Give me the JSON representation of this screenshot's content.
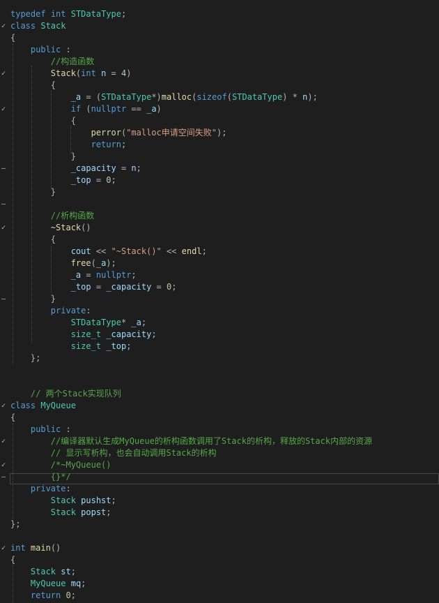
{
  "colors": {
    "background": "#1e1e1e",
    "keyword": "#569cd6",
    "type": "#4ec9b0",
    "function": "#dcdcaa",
    "variable": "#9cdcfe",
    "number": "#b5cea8",
    "string": "#d69d85",
    "comment": "#57a64a",
    "punctuation": "#b4b4b4",
    "macro": "#beb7ff"
  },
  "lines": [
    {
      "fold": "",
      "tokens": [
        [
          "kw",
          "typedef"
        ],
        [
          "pun",
          " "
        ],
        [
          "kw",
          "int"
        ],
        [
          "pun",
          " "
        ],
        [
          "type",
          "STDataType"
        ],
        [
          "pun",
          ";"
        ]
      ]
    },
    {
      "fold": "✓",
      "tokens": [
        [
          "kw",
          "class"
        ],
        [
          "pun",
          " "
        ],
        [
          "type",
          "Stack"
        ]
      ]
    },
    {
      "fold": "",
      "tokens": [
        [
          "pun",
          "{"
        ]
      ]
    },
    {
      "fold": "",
      "tokens": [
        [
          "pun",
          "    "
        ],
        [
          "kw",
          "public"
        ],
        [
          "pun",
          " :"
        ]
      ]
    },
    {
      "fold": "",
      "tokens": [
        [
          "pun",
          "        "
        ],
        [
          "cmt",
          "//构造函数"
        ]
      ]
    },
    {
      "fold": "✓",
      "tokens": [
        [
          "pun",
          "        "
        ],
        [
          "fn",
          "Stack"
        ],
        [
          "pun",
          "("
        ],
        [
          "kw",
          "int"
        ],
        [
          "pun",
          " "
        ],
        [
          "var",
          "n"
        ],
        [
          "pun",
          " = "
        ],
        [
          "num",
          "4"
        ],
        [
          "pun",
          ")"
        ]
      ]
    },
    {
      "fold": "",
      "tokens": [
        [
          "pun",
          "        {"
        ]
      ]
    },
    {
      "fold": "",
      "tokens": [
        [
          "pun",
          "            "
        ],
        [
          "var",
          "_a"
        ],
        [
          "pun",
          " = ("
        ],
        [
          "type",
          "STDataType"
        ],
        [
          "pun",
          "*)"
        ],
        [
          "fn",
          "malloc"
        ],
        [
          "pun",
          "("
        ],
        [
          "kw",
          "sizeof"
        ],
        [
          "pun",
          "("
        ],
        [
          "type",
          "STDataType"
        ],
        [
          "pun",
          ") * "
        ],
        [
          "var",
          "n"
        ],
        [
          "pun",
          ");"
        ]
      ]
    },
    {
      "fold": "✓",
      "tokens": [
        [
          "pun",
          "            "
        ],
        [
          "kw",
          "if"
        ],
        [
          "pun",
          " ("
        ],
        [
          "kw",
          "nullptr"
        ],
        [
          "pun",
          " == "
        ],
        [
          "var",
          "_a"
        ],
        [
          "pun",
          ")"
        ]
      ]
    },
    {
      "fold": "",
      "tokens": [
        [
          "pun",
          "            {"
        ]
      ]
    },
    {
      "fold": "",
      "tokens": [
        [
          "pun",
          "                "
        ],
        [
          "fn",
          "perror"
        ],
        [
          "pun",
          "("
        ],
        [
          "str",
          "\"malloc申请空间失败\""
        ],
        [
          "pun",
          ");"
        ]
      ]
    },
    {
      "fold": "",
      "tokens": [
        [
          "pun",
          "                "
        ],
        [
          "kw",
          "return"
        ],
        [
          "pun",
          ";"
        ]
      ]
    },
    {
      "fold": "",
      "tokens": [
        [
          "pun",
          "            }"
        ]
      ]
    },
    {
      "fold": "–",
      "tokens": [
        [
          "pun",
          "            "
        ],
        [
          "var",
          "_capacity"
        ],
        [
          "pun",
          " = "
        ],
        [
          "var",
          "n"
        ],
        [
          "pun",
          ";"
        ]
      ]
    },
    {
      "fold": "",
      "tokens": [
        [
          "pun",
          "            "
        ],
        [
          "var",
          "_top"
        ],
        [
          "pun",
          " = "
        ],
        [
          "num",
          "0"
        ],
        [
          "pun",
          ";"
        ]
      ]
    },
    {
      "fold": "",
      "tokens": [
        [
          "pun",
          "        }"
        ]
      ]
    },
    {
      "fold": "–",
      "tokens": []
    },
    {
      "fold": "",
      "tokens": [
        [
          "pun",
          "        "
        ],
        [
          "cmt",
          "//析构函数"
        ]
      ]
    },
    {
      "fold": "✓",
      "tokens": [
        [
          "pun",
          "        "
        ],
        [
          "fn",
          "~Stack"
        ],
        [
          "pun",
          "()"
        ]
      ]
    },
    {
      "fold": "",
      "tokens": [
        [
          "pun",
          "        {"
        ]
      ]
    },
    {
      "fold": "",
      "tokens": [
        [
          "pun",
          "            "
        ],
        [
          "var",
          "cout"
        ],
        [
          "pun",
          " << "
        ],
        [
          "str",
          "\"~Stack()\""
        ],
        [
          "pun",
          " << "
        ],
        [
          "fn",
          "endl"
        ],
        [
          "pun",
          ";"
        ]
      ]
    },
    {
      "fold": "",
      "tokens": [
        [
          "pun",
          "            "
        ],
        [
          "fn",
          "free"
        ],
        [
          "pun",
          "("
        ],
        [
          "var",
          "_a"
        ],
        [
          "pun",
          ");"
        ]
      ]
    },
    {
      "fold": "",
      "tokens": [
        [
          "pun",
          "            "
        ],
        [
          "var",
          "_a"
        ],
        [
          "pun",
          " = "
        ],
        [
          "kw",
          "nullptr"
        ],
        [
          "pun",
          ";"
        ]
      ]
    },
    {
      "fold": "",
      "tokens": [
        [
          "pun",
          "            "
        ],
        [
          "var",
          "_top"
        ],
        [
          "pun",
          " = "
        ],
        [
          "var",
          "_capacity"
        ],
        [
          "pun",
          " = "
        ],
        [
          "num",
          "0"
        ],
        [
          "pun",
          ";"
        ]
      ]
    },
    {
      "fold": "–",
      "tokens": [
        [
          "pun",
          "        }"
        ]
      ]
    },
    {
      "fold": "",
      "tokens": [
        [
          "pun",
          "        "
        ],
        [
          "kw",
          "private"
        ],
        [
          "pun",
          ":"
        ]
      ]
    },
    {
      "fold": "",
      "tokens": [
        [
          "pun",
          "            "
        ],
        [
          "type",
          "STDataType"
        ],
        [
          "pun",
          "* "
        ],
        [
          "var",
          "_a"
        ],
        [
          "pun",
          ";"
        ]
      ]
    },
    {
      "fold": "",
      "tokens": [
        [
          "pun",
          "            "
        ],
        [
          "type",
          "size_t"
        ],
        [
          "pun",
          " "
        ],
        [
          "var",
          "_capacity"
        ],
        [
          "pun",
          ";"
        ]
      ]
    },
    {
      "fold": "",
      "tokens": [
        [
          "pun",
          "            "
        ],
        [
          "type",
          "size_t"
        ],
        [
          "pun",
          " "
        ],
        [
          "var",
          "_top"
        ],
        [
          "pun",
          ";"
        ]
      ]
    },
    {
      "fold": "",
      "tokens": [
        [
          "pun",
          "    };"
        ]
      ]
    },
    {
      "fold": "",
      "tokens": []
    },
    {
      "fold": "",
      "tokens": []
    },
    {
      "fold": "",
      "tokens": [
        [
          "pun",
          "    "
        ],
        [
          "cmt",
          "// 两个Stack实现队列"
        ]
      ]
    },
    {
      "fold": "✓",
      "tokens": [
        [
          "kw",
          "class"
        ],
        [
          "pun",
          " "
        ],
        [
          "type",
          "MyQueue"
        ]
      ]
    },
    {
      "fold": "",
      "tokens": [
        [
          "pun",
          "{"
        ]
      ]
    },
    {
      "fold": "",
      "tokens": [
        [
          "pun",
          "    "
        ],
        [
          "kw",
          "public"
        ],
        [
          "pun",
          " :"
        ]
      ]
    },
    {
      "fold": "✓",
      "tokens": [
        [
          "pun",
          "        "
        ],
        [
          "cmt",
          "//编译器默认生成MyQueue的析构函数调用了Stack的析构，释放的Stack内部的资源"
        ]
      ]
    },
    {
      "fold": "",
      "tokens": [
        [
          "pun",
          "        "
        ],
        [
          "cmt",
          "// 显示写析构，也会自动调用Stack的析构"
        ]
      ]
    },
    {
      "fold": "✓",
      "tokens": [
        [
          "pun",
          "        "
        ],
        [
          "cmt",
          "/*~MyQueue()"
        ]
      ]
    },
    {
      "fold": "–",
      "tokens": [
        [
          "pun",
          "        "
        ],
        [
          "cmt",
          "{}*/"
        ]
      ]
    },
    {
      "fold": "",
      "tokens": [
        [
          "pun",
          "    "
        ],
        [
          "kw",
          "private"
        ],
        [
          "pun",
          ":"
        ]
      ]
    },
    {
      "fold": "",
      "tokens": [
        [
          "pun",
          "        "
        ],
        [
          "type",
          "Stack"
        ],
        [
          "pun",
          " "
        ],
        [
          "var",
          "pushst"
        ],
        [
          "pun",
          ";"
        ]
      ]
    },
    {
      "fold": "",
      "tokens": [
        [
          "pun",
          "        "
        ],
        [
          "type",
          "Stack"
        ],
        [
          "pun",
          " "
        ],
        [
          "var",
          "popst"
        ],
        [
          "pun",
          ";"
        ]
      ]
    },
    {
      "fold": "",
      "tokens": [
        [
          "pun",
          "};"
        ]
      ]
    },
    {
      "fold": "",
      "tokens": []
    },
    {
      "fold": "✓",
      "tokens": [
        [
          "kw",
          "int"
        ],
        [
          "pun",
          " "
        ],
        [
          "fn",
          "main"
        ],
        [
          "pun",
          "()"
        ]
      ]
    },
    {
      "fold": "",
      "tokens": [
        [
          "pun",
          "{"
        ]
      ]
    },
    {
      "fold": "",
      "tokens": [
        [
          "pun",
          "    "
        ],
        [
          "type",
          "Stack"
        ],
        [
          "pun",
          " "
        ],
        [
          "var",
          "st"
        ],
        [
          "pun",
          ";"
        ]
      ]
    },
    {
      "fold": "",
      "tokens": [
        [
          "pun",
          "    "
        ],
        [
          "type",
          "MyQueue"
        ],
        [
          "pun",
          " "
        ],
        [
          "var",
          "mq"
        ],
        [
          "pun",
          ";"
        ]
      ]
    },
    {
      "fold": "",
      "tokens": [
        [
          "pun",
          "    "
        ],
        [
          "kw",
          "return"
        ],
        [
          "pun",
          " "
        ],
        [
          "num",
          "0"
        ],
        [
          "pun",
          ";"
        ]
      ]
    }
  ]
}
